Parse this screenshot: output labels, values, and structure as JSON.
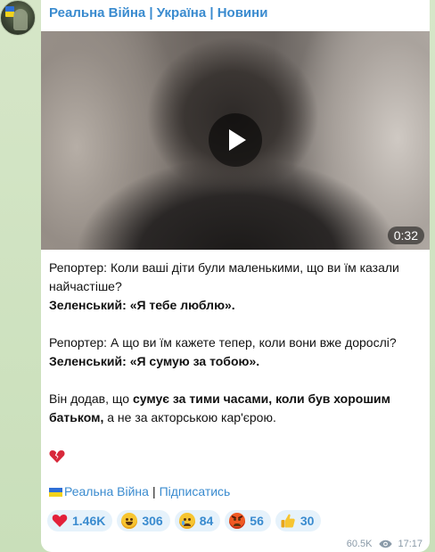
{
  "channel": {
    "title": "Реальна Війна | Україна | Новини"
  },
  "video": {
    "duration": "0:32"
  },
  "post": {
    "line1": "Репортер: Коли ваші діти були маленькими, що ви їм казали найчастіше?",
    "line2_speaker": "Зеленський:",
    "line2_quote": "«Я тебе люблю».",
    "line3": "Репортер: А що ви їм кажете тепер, коли вони вже дорослі?",
    "line4_speaker": "Зеленський:",
    "line4_quote": "«Я сумую за тобою».",
    "line5_a": "Він додав, що ",
    "line5_b": "сумує за тими часами, коли був хорошим батьком,",
    "line5_c": " а не за акторською кар'єрою."
  },
  "footer": {
    "channel_link": "Реальна Війна",
    "separator": "|",
    "subscribe_link": "Підписатись"
  },
  "reactions": [
    {
      "icon": "red-heart-icon",
      "count": "1.46K"
    },
    {
      "icon": "grinning-face-icon",
      "count": "306"
    },
    {
      "icon": "crying-face-icon",
      "count": "84"
    },
    {
      "icon": "angry-face-icon",
      "count": "56"
    },
    {
      "icon": "thumbs-up-icon",
      "count": "30"
    }
  ],
  "meta": {
    "views": "60.5K",
    "time": "17:17"
  },
  "colors": {
    "link": "#3a8bcf",
    "reaction_bg": "#e6f2fb",
    "background": "#cfe3c2"
  }
}
